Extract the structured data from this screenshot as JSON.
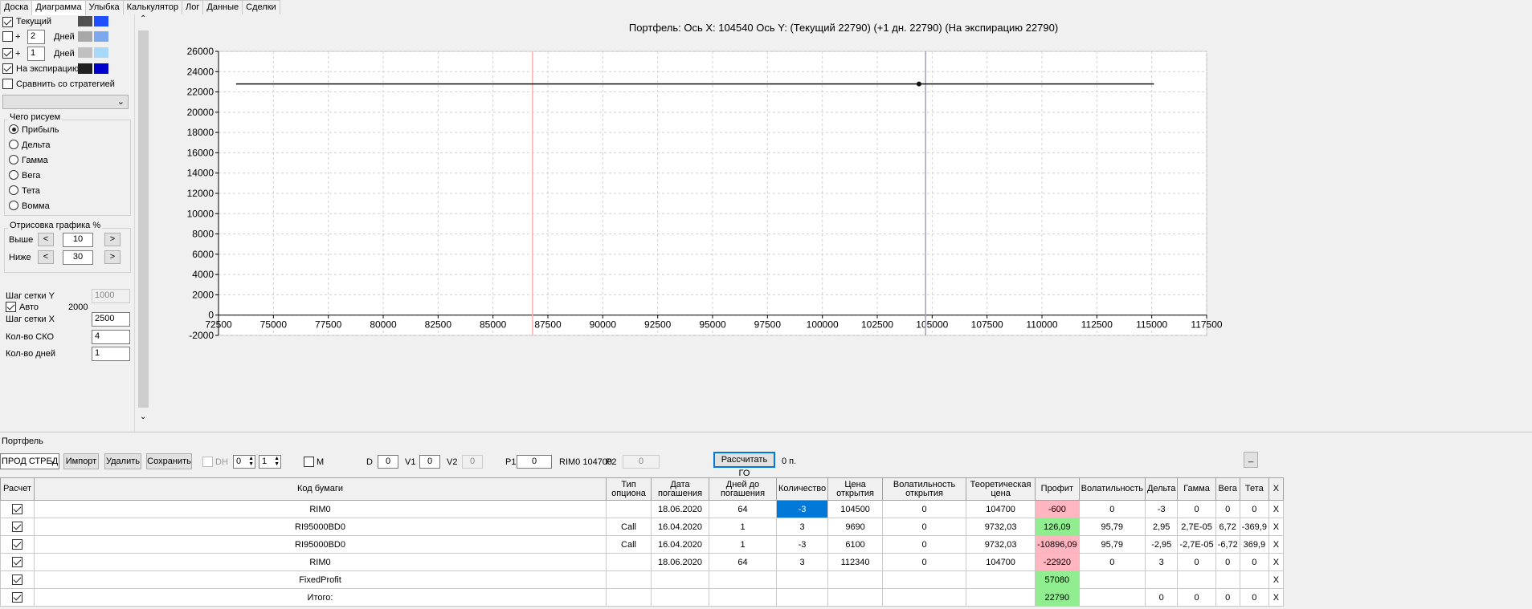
{
  "tabs": [
    "Доска",
    "Диаграмма",
    "Улыбка",
    "Калькулятор",
    "Лог",
    "Данные",
    "Сделки"
  ],
  "active_tab": "Диаграмма",
  "colors": {
    "current_dark": "#505050",
    "current_blue": "#1f4fff",
    "plus1_a": "#a8a8a8",
    "plus1_b": "#7da8f0",
    "plus2_a": "#c0c0c0",
    "plus2_b": "#a8d8f8",
    "exp_a": "#202020",
    "exp_b": "#0000cc",
    "pink": "#ffb6c1",
    "green": "#90ee90",
    "selected": "#0078d7"
  },
  "left": {
    "current_label": "Текущий",
    "plus_label": "+",
    "days_label": "Дней",
    "days1": "2",
    "days2": "1",
    "expiry_label": "На экспирацию",
    "compare_label": "Сравнить со стратегией",
    "what_group": "Чего рисуем",
    "what_options": [
      "Прибыль",
      "Дельта",
      "Гамма",
      "Вега",
      "Тета",
      "Вомма"
    ],
    "draw_group": "Отрисовка графика %",
    "above_label": "Выше",
    "above_value": "10",
    "below_label": "Ниже",
    "below_value": "30",
    "lt": "<",
    "gt": ">",
    "grid_y_label": "Шаг сетки Y",
    "grid_y_value": "1000",
    "auto_label": "Авто",
    "auto_value": "2000",
    "grid_x_label": "Шаг сетки X",
    "grid_x_value": "2500",
    "sko_label": "Кол-во СКО",
    "sko_value": "4",
    "days_count_label": "Кол-во дней",
    "days_count_value": "1"
  },
  "chart_data": {
    "type": "line",
    "title": "Портфель: Ось X: 104540 Ось Y:  (Текущий 22790)  (+1 дн. 22790)  (На экспирацию 22790)",
    "xlim": [
      72500,
      117500
    ],
    "ylim": [
      -2000,
      26000
    ],
    "x_ticks": [
      72500,
      75000,
      77500,
      80000,
      82500,
      85000,
      87500,
      90000,
      92500,
      95000,
      97500,
      100000,
      102500,
      105000,
      107500,
      110000,
      112500,
      115000,
      117500
    ],
    "y_ticks": [
      -2000,
      0,
      2000,
      4000,
      6000,
      8000,
      10000,
      12000,
      14000,
      16000,
      18000,
      20000,
      22000,
      24000,
      26000
    ],
    "series": [
      {
        "x": [
          73300,
          115100
        ],
        "y": [
          22790,
          22790
        ]
      }
    ],
    "marker": {
      "x": 104400,
      "y": 22790
    },
    "vlines": [
      {
        "x": 86800,
        "color": "#ffb0b0"
      },
      {
        "x": 104700,
        "color": "#a0a0c0"
      }
    ],
    "grid": true
  },
  "portfolio": {
    "label": "Портфель",
    "strategy": "ПРОД СТРЕД",
    "import": "Импорт",
    "delete": "Удалить",
    "save": "Сохранить",
    "dh": "DH",
    "spin1": "0",
    "spin2": "1",
    "m": "M",
    "d_label": "D",
    "d_value": "0",
    "v1_label": "V1",
    "v1_value": "0",
    "v2_label": "V2",
    "v2_value": "0",
    "p1_label": "P1",
    "p1_value": "0",
    "rim_label": "RIM0 104700",
    "p2_label": "P2",
    "p2_value": "0",
    "calc_go": "Рассчитать ГО",
    "points": "0 п.",
    "minimize": "_"
  },
  "table": {
    "headers": [
      "Расчет",
      "Код бумаги",
      "Тип опциона",
      "Дата погашения",
      "Дней до погашения",
      "Количество",
      "Цена открытия",
      "Волатильность открытия",
      "Теоретическая цена",
      "Профит",
      "Волатильность",
      "Дельта",
      "Гамма",
      "Вега",
      "Тета",
      "X"
    ],
    "rows": [
      [
        "",
        "RIM0",
        "",
        "18.06.2020",
        "64",
        "-3",
        "104500",
        "0",
        "104700",
        "-600",
        "0",
        "-3",
        "0",
        "0",
        "0",
        "X"
      ],
      [
        "",
        "RI95000BD0",
        "Call",
        "16.04.2020",
        "1",
        "3",
        "9690",
        "0",
        "9732,03",
        "126,09",
        "95,79",
        "2,95",
        "2,7E-05",
        "6,72",
        "-369,9",
        "X"
      ],
      [
        "",
        "RI95000BD0",
        "Call",
        "16.04.2020",
        "1",
        "-3",
        "6100",
        "0",
        "9732,03",
        "-10896,09",
        "95,79",
        "-2,95",
        "-2,7E-05",
        "-6,72",
        "369,9",
        "X"
      ],
      [
        "",
        "RIM0",
        "",
        "18.06.2020",
        "64",
        "3",
        "112340",
        "0",
        "104700",
        "-22920",
        "0",
        "3",
        "0",
        "0",
        "0",
        "X"
      ],
      [
        "",
        "FixedProfit",
        "",
        "",
        "",
        "",
        "",
        "",
        "",
        "57080",
        "",
        "",
        "",
        "",
        "",
        "X"
      ],
      [
        "",
        "Итого:",
        "",
        "",
        "",
        "",
        "",
        "",
        "",
        "22790",
        "",
        "0",
        "0",
        "0",
        "0",
        "X"
      ]
    ],
    "profit_status": [
      "pink",
      "green",
      "pink",
      "pink",
      "green",
      "green"
    ]
  }
}
